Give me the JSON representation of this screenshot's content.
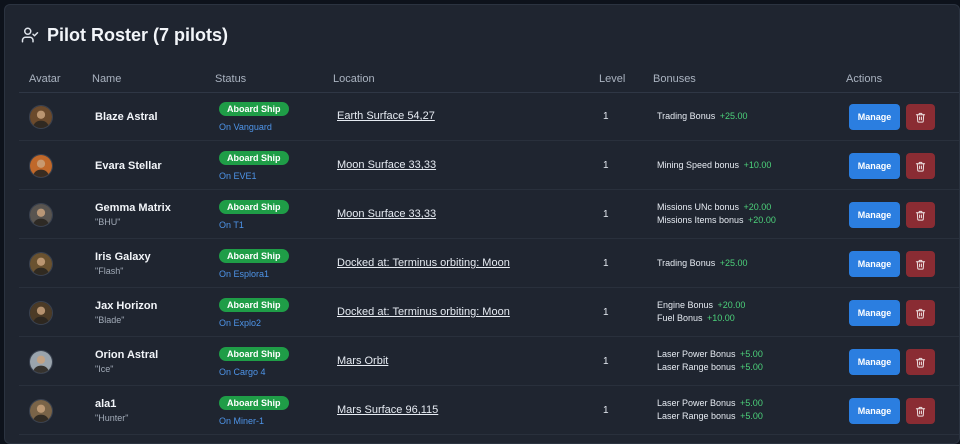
{
  "header": {
    "title": "Pilot Roster (7 pilots)",
    "icon": "user-check-icon"
  },
  "table": {
    "columns": [
      "Avatar",
      "Name",
      "Status",
      "Location",
      "Level",
      "Bonuses",
      "Actions"
    ],
    "manage_label": "Manage",
    "rows": [
      {
        "name": "Blaze Astral",
        "nickname": "",
        "status": "Aboard Ship",
        "ship": "On Vanguard",
        "location": "Earth Surface 54,27",
        "level": "1",
        "bonuses": [
          {
            "label": "Trading Bonus",
            "value": "+25.00"
          }
        ]
      },
      {
        "name": "Evara Stellar",
        "nickname": "",
        "status": "Aboard Ship",
        "ship": "On EVE1",
        "location": "Moon Surface 33,33",
        "level": "1",
        "bonuses": [
          {
            "label": "Mining Speed bonus",
            "value": "+10.00"
          }
        ]
      },
      {
        "name": "Gemma Matrix",
        "nickname": "\"BHU\"",
        "status": "Aboard Ship",
        "ship": "On T1",
        "location": "Moon Surface 33,33",
        "level": "1",
        "bonuses": [
          {
            "label": "Missions UNc bonus",
            "value": "+20.00"
          },
          {
            "label": "Missions Items bonus",
            "value": "+20.00"
          }
        ]
      },
      {
        "name": "Iris Galaxy",
        "nickname": "\"Flash\"",
        "status": "Aboard Ship",
        "ship": "On Esplora1",
        "location": "Docked at: Terminus orbiting: Moon",
        "level": "1",
        "bonuses": [
          {
            "label": "Trading Bonus",
            "value": "+25.00"
          }
        ]
      },
      {
        "name": "Jax Horizon",
        "nickname": "\"Blade\"",
        "status": "Aboard Ship",
        "ship": "On Explo2",
        "location": "Docked at: Terminus orbiting: Moon",
        "level": "1",
        "bonuses": [
          {
            "label": "Engine Bonus",
            "value": "+20.00"
          },
          {
            "label": "Fuel Bonus",
            "value": "+10.00"
          }
        ]
      },
      {
        "name": "Orion Astral",
        "nickname": "\"Ice\"",
        "status": "Aboard Ship",
        "ship": "On Cargo 4",
        "location": "Mars Orbit",
        "level": "1",
        "bonuses": [
          {
            "label": "Laser Power Bonus",
            "value": "+5.00"
          },
          {
            "label": "Laser Range bonus",
            "value": "+5.00"
          }
        ]
      },
      {
        "name": "ala1",
        "nickname": "\"Hunter\"",
        "status": "Aboard Ship",
        "ship": "On Miner-1",
        "location": "Mars Surface 96,115",
        "level": "1",
        "bonuses": [
          {
            "label": "Laser Power Bonus",
            "value": "+5.00"
          },
          {
            "label": "Laser Range bonus",
            "value": "+5.00"
          }
        ]
      }
    ]
  },
  "colors": {
    "background": "#1f2530",
    "badge_green": "#1f9d47",
    "ship_link": "#4e94e8",
    "bonus_value": "#4cd17a",
    "manage_button": "#2b7ee0",
    "delete_button": "#8a2c33"
  },
  "avatar_styles": [
    "#6b4a2c",
    "#c0682a",
    "#585450",
    "#6a5230",
    "#4c3b26",
    "#9aa4ad",
    "#7a6448"
  ]
}
